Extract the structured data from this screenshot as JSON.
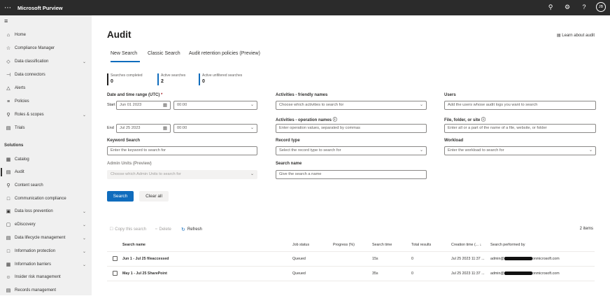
{
  "topbar": {
    "app_title": "Microsoft Purview",
    "icons": [
      "waffle-icon",
      "key-icon",
      "gear-icon",
      "help-icon"
    ],
    "avatar_initials": "JB"
  },
  "sidebar": {
    "items": [
      {
        "label": "Home",
        "icon": "home-icon"
      },
      {
        "label": "Compliance Manager",
        "icon": "trophy-icon"
      },
      {
        "label": "Data classification",
        "icon": "tag-icon",
        "chevron": true
      },
      {
        "label": "Data connectors",
        "icon": "plug-icon"
      },
      {
        "label": "Alerts",
        "icon": "alert-icon"
      },
      {
        "label": "Policies",
        "icon": "policies-icon"
      },
      {
        "label": "Roles & scopes",
        "icon": "roles-icon",
        "chevron": true
      },
      {
        "label": "Trials",
        "icon": "trials-icon"
      }
    ],
    "section_label": "Solutions",
    "solution_items": [
      {
        "label": "Catalog",
        "icon": "catalog-icon"
      },
      {
        "label": "Audit",
        "icon": "audit-icon",
        "active": true
      },
      {
        "label": "Content search",
        "icon": "search-icon"
      },
      {
        "label": "Communication compliance",
        "icon": "chat-icon"
      },
      {
        "label": "Data loss prevention",
        "icon": "dlp-icon",
        "chevron": true
      },
      {
        "label": "eDiscovery",
        "icon": "ediscovery-icon",
        "chevron": true
      },
      {
        "label": "Data lifecycle management",
        "icon": "lifecycle-icon",
        "chevron": true
      },
      {
        "label": "Information protection",
        "icon": "lock-icon",
        "chevron": true
      },
      {
        "label": "Information barriers",
        "icon": "barrier-icon",
        "chevron": true
      },
      {
        "label": "Insider risk management",
        "icon": "person-icon"
      },
      {
        "label": "Records management",
        "icon": "records-icon"
      }
    ]
  },
  "main": {
    "title": "Audit",
    "learn_link": "Learn about audit",
    "tabs": [
      "New Search",
      "Classic Search",
      "Audit retention policies (Preview)"
    ],
    "stats": [
      {
        "label": "Searches completed",
        "value": "0"
      },
      {
        "label": "Active searches",
        "value": "2"
      },
      {
        "label": "Active unfiltered searches",
        "value": "0"
      }
    ],
    "form": {
      "date_label": "Date and time range (UTC)",
      "required_mark": "*",
      "start_label": "Start",
      "start_date": "Jun 01 2023",
      "start_time": "00:00",
      "end_label": "End",
      "end_date": "Jul 25 2023",
      "end_time": "00:00",
      "keyword_label": "Keyword Search",
      "keyword_placeholder": "Enter the keyword to search for",
      "admin_units_label": "Admin Units (Preview)",
      "admin_units_placeholder": "Choose which Admin Units to search for",
      "activities_friendly_label": "Activities - friendly names",
      "activities_friendly_placeholder": "Choose which activities to search for",
      "activities_ops_label": "Activities - operation names",
      "activities_ops_placeholder": "Enter operation values, separated by commas",
      "record_type_label": "Record type",
      "record_type_placeholder": "Select the record type to search for",
      "search_name_label": "Search name",
      "search_name_placeholder": "Give the search a name",
      "users_label": "Users",
      "users_placeholder": "Add the users whose audit logs you want to search",
      "file_label": "File, folder, or site",
      "file_placeholder": "Enter all or a part of the name of a file, website, or folder",
      "workload_label": "Workload",
      "workload_placeholder": "Enter the workload to search for"
    },
    "buttons": {
      "search": "Search",
      "clear": "Clear all"
    },
    "toolbar": {
      "copy": "Copy this search",
      "delete": "Delete",
      "refresh": "Refresh",
      "count": "2 items"
    },
    "table": {
      "headers": [
        "Search name",
        "Job status",
        "Progress (%)",
        "Search time",
        "Total results",
        "Creation time (... ↓",
        "Search performed by"
      ],
      "rows": [
        {
          "name": "Jun 1 - Jul 25 fileaccessed",
          "status": "Queued",
          "progress": "",
          "time": "15s",
          "results": "0",
          "created": "Jul 25 2023 11:37 ...",
          "by_prefix": "admin@",
          "by_suffix": "onmicrosoft.com"
        },
        {
          "name": "May 1 - Jul 25 SharePoint",
          "status": "Queued",
          "progress": "",
          "time": "35s",
          "results": "0",
          "created": "Jul 25 2023 11:37 ...",
          "by_prefix": "admin@",
          "by_suffix": "onmicrosoft.com"
        }
      ]
    }
  }
}
